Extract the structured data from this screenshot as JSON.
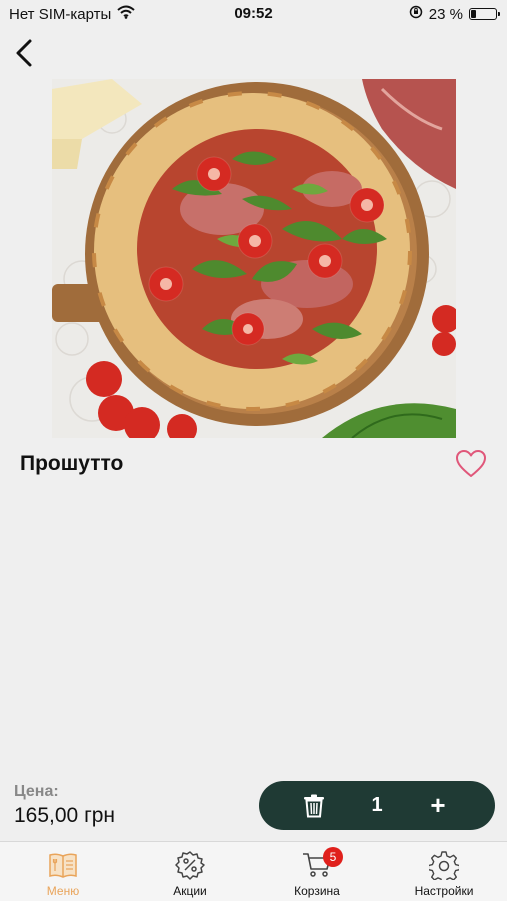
{
  "status_bar": {
    "carrier": "Нет SIM-карты",
    "time": "09:52",
    "battery_text": "23 %",
    "battery_level": 0.23
  },
  "product": {
    "title": "Прошутто",
    "image_alt": "Pizza photo"
  },
  "price": {
    "label": "Цена:",
    "value": "165,00 грн"
  },
  "cart_control": {
    "quantity": "1",
    "plus": "+"
  },
  "tabs": [
    {
      "label": "Меню",
      "icon": "menu-book-icon",
      "active": true
    },
    {
      "label": "Акции",
      "icon": "discount-icon",
      "active": false
    },
    {
      "label": "Корзина",
      "icon": "cart-icon",
      "active": false,
      "badge": "5"
    },
    {
      "label": "Настройки",
      "icon": "gear-icon",
      "active": false
    }
  ],
  "colors": {
    "accent": "#e9a45a",
    "pill": "#1f3a34",
    "heart": "#e0577a",
    "badge": "#e0201c"
  }
}
